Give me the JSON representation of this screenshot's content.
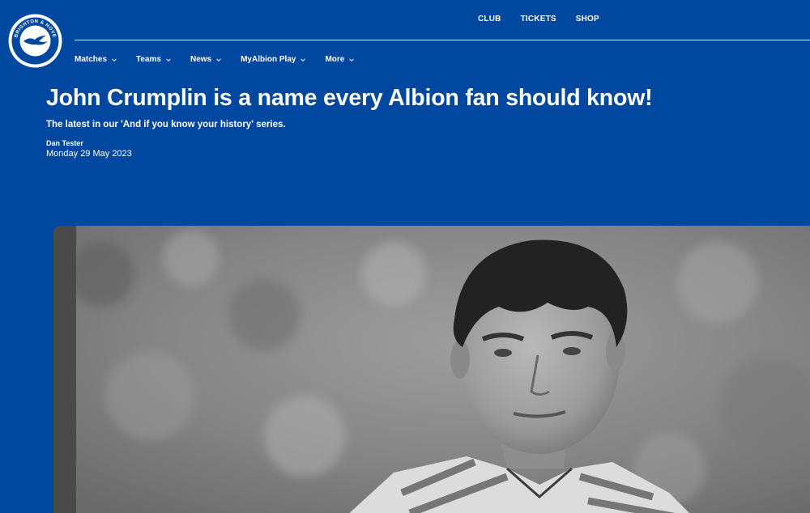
{
  "site": {
    "crest_icon": "brighton-crest-icon",
    "crest_text_top": "BRIGHTON & HOVE",
    "crest_text_bottom": "ALBION",
    "brand_color": "#0047a0"
  },
  "top_links": [
    {
      "label": "CLUB"
    },
    {
      "label": "TICKETS"
    },
    {
      "label": "SHOP"
    }
  ],
  "main_nav": [
    {
      "label": "Matches",
      "icon": "chevron-down-icon"
    },
    {
      "label": "Teams",
      "icon": "chevron-down-icon"
    },
    {
      "label": "News",
      "icon": "chevron-down-icon"
    },
    {
      "label": "MyAlbion Play",
      "icon": "chevron-down-icon"
    },
    {
      "label": "More",
      "icon": "chevron-down-icon"
    }
  ],
  "article": {
    "title": "John Crumplin is a name every Albion fan should know!",
    "standfirst": "The latest in our 'And if you know your history' series.",
    "author": "Dan Tester",
    "date": "Monday 29 May 2023",
    "hero_image": "black-and-white-photo-of-footballer"
  }
}
